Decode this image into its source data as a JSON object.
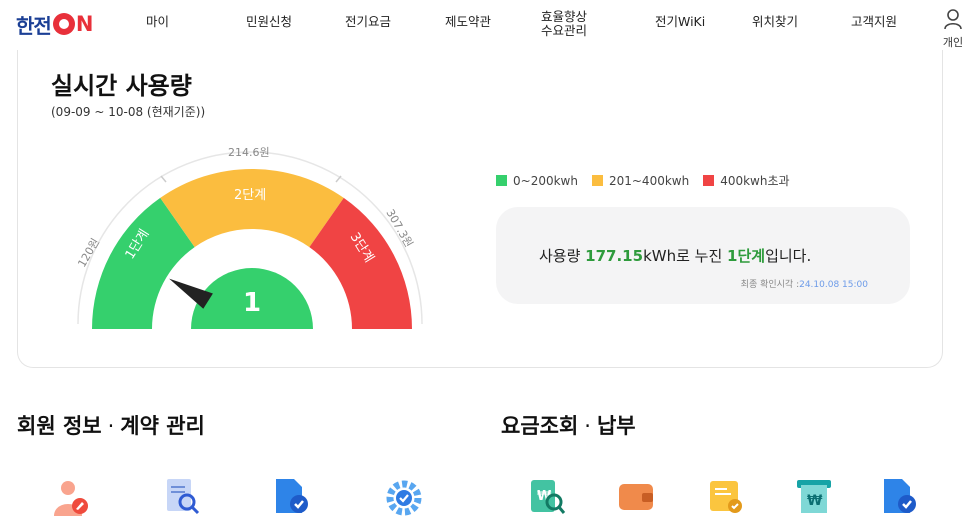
{
  "header": {
    "logo": {
      "text": "한전",
      "on": "ON"
    },
    "nav": [
      {
        "label": "마이"
      },
      {
        "label": "민원신청"
      },
      {
        "label": "전기요금"
      },
      {
        "label": "제도약관"
      },
      {
        "label": "효율향상\n수요관리"
      },
      {
        "label": "전기WiKi"
      },
      {
        "label": "위치찾기"
      },
      {
        "label": "고객지원"
      }
    ],
    "user_label": "개인"
  },
  "usage": {
    "title": "실시간 사용량",
    "period": "(09-09 ~ 10-08 (현재기준))",
    "gauge": {
      "current_level": "1",
      "level_labels": [
        "1단계",
        "2단계",
        "3단계"
      ],
      "threshold_labels": [
        "120원",
        "214.6원",
        "307.3원"
      ],
      "colors": {
        "level1": "#35d06d",
        "level2": "#fbbd3f",
        "level3": "#f04444"
      },
      "needle_fraction": 0.18
    },
    "legend": [
      {
        "label": "0~200kwh",
        "color": "#35d06d"
      },
      {
        "label": "201~400kwh",
        "color": "#fbbd3f"
      },
      {
        "label": "400kwh초과",
        "color": "#f04444"
      }
    ],
    "summary": {
      "prefix": "사용량 ",
      "amount": "177.15",
      "mid": "kWh로 누진 ",
      "level": "1단계",
      "suffix": "입니다."
    },
    "checked": {
      "label": "최종 확인시각 :",
      "datetime": "24.10.08 15:00"
    }
  },
  "sections": {
    "membership": {
      "title": "회원 정보",
      "sep": "·",
      "title2": "계약 관리"
    },
    "billing": {
      "title": "요금조회",
      "sep": "·",
      "title2": "납부"
    }
  },
  "service_icons": [
    "user-edit-icon",
    "document-search-icon",
    "file-check-icon",
    "gear-check-icon",
    "receipt-search-icon",
    "wallet-icon",
    "bill-check-icon",
    "receipt-won-icon",
    "file-check-icon"
  ]
}
